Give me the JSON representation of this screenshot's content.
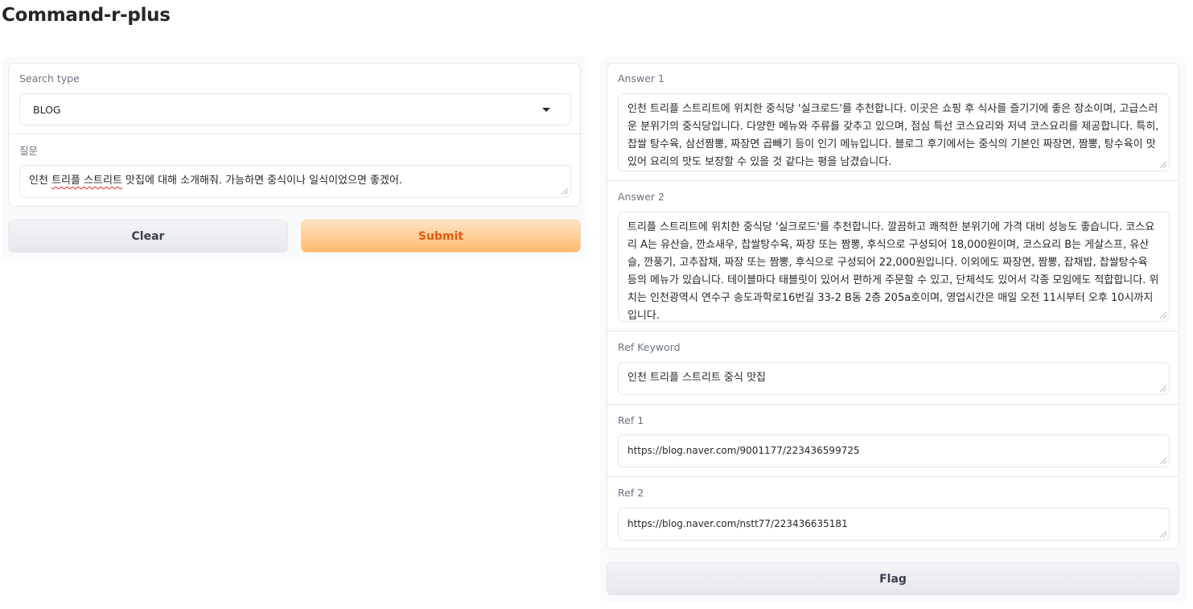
{
  "app": {
    "title": "Command-r-plus"
  },
  "inputs": {
    "search_type": {
      "label": "Search type",
      "value": "BLOG"
    },
    "question": {
      "label": "질문",
      "value_before": "인천 ",
      "value_spell": "트리플 스트리트",
      "value_after": " 맛집에 대해 소개해줘. 가능하면 중식이나 일식이었으면 좋겠어."
    }
  },
  "buttons": {
    "clear": "Clear",
    "submit": "Submit",
    "flag": "Flag"
  },
  "outputs": {
    "answer1": {
      "label": "Answer 1",
      "value": "인천 트리플 스트리트에 위치한 중식당 '실크로드'를 추천합니다. 이곳은 쇼핑 후 식사를 즐기기에 좋은 장소이며, 고급스러운 분위기의 중식당입니다. 다양한 메뉴와 주류를 갖추고 있으며, 점심 특선 코스요리와 저녁 코스요리를 제공합니다. 특히, 찹쌀 탕수육, 삼선짬뽕, 짜장면 곱빼기 등이 인기 메뉴입니다. 블로그 후기에서는 중식의 기본인 짜장면, 짬뽕, 탕수육이 맛있어 요리의 맛도 보장할 수 있을 것 같다는 평을 남겼습니다."
    },
    "answer2": {
      "label": "Answer 2",
      "value": "트리플 스트리트에 위치한 중식당 '실크로드'를 추천합니다. 깔끔하고 쾌적한 분위기에 가격 대비 성능도 좋습니다. 코스요리 A는 유산슬, 깐쇼새우, 찹쌀탕수육, 짜장 또는 짬뽕, 후식으로 구성되어 18,000원이며, 코스요리 B는 게살스프, 유산슬, 깐풍기, 고추잡채, 짜장 또는 짬뽕, 후식으로 구성되어 22,000원입니다. 이외에도 짜장면, 짬뽕, 잡채밥, 찹쌀탕수육 등의 메뉴가 있습니다. 테이블마다 태블릿이 있어서 편하게 주문할 수 있고, 단체석도 있어서 각종 모임에도 적합합니다. 위치는 인천광역시 연수구 송도과학로16번길 33-2 B동 2층 205a호이며, 영업시간은 매일 오전 11시부터 오후 10시까지입니다."
    },
    "ref_keyword": {
      "label": "Ref Keyword",
      "value": "인천 트리플 스트리트 중식 맛집"
    },
    "ref1": {
      "label": "Ref 1",
      "value": "https://blog.naver.com/9001177/223436599725"
    },
    "ref2": {
      "label": "Ref 2",
      "value": "https://blog.naver.com/nstt77/223436635181"
    }
  }
}
